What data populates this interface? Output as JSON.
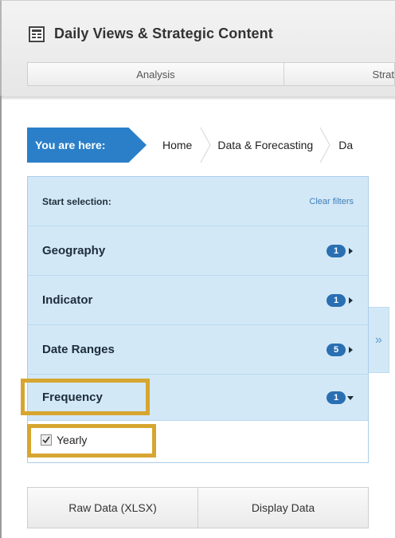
{
  "app": {
    "title": "Daily Views & Strategic Content",
    "icon": "report-icon"
  },
  "nav": {
    "tabs": [
      {
        "label": "Analysis"
      },
      {
        "label": "Strat"
      }
    ]
  },
  "breadcrumb": {
    "here": "You are here:",
    "items": [
      {
        "label": "Home"
      },
      {
        "label": "Data & Forecasting"
      },
      {
        "label": "Da"
      }
    ]
  },
  "filters": {
    "start_label": "Start selection:",
    "clear_label": "Clear filters",
    "facets": [
      {
        "label": "Geography",
        "count": "1",
        "expanded": false
      },
      {
        "label": "Indicator",
        "count": "1",
        "expanded": false
      },
      {
        "label": "Date Ranges",
        "count": "5",
        "expanded": false
      },
      {
        "label": "Frequency",
        "count": "1",
        "expanded": true
      }
    ],
    "frequency_options": [
      {
        "label": "Yearly",
        "checked": true
      }
    ]
  },
  "side_toggle": {
    "glyph": "»"
  },
  "actions": {
    "raw": "Raw Data (XLSX)",
    "display": "Display Data"
  },
  "colors": {
    "accent": "#2b7fc8",
    "panel": "#d3e8f7",
    "badge": "#2a6fb2",
    "highlight": "#d6a630"
  }
}
